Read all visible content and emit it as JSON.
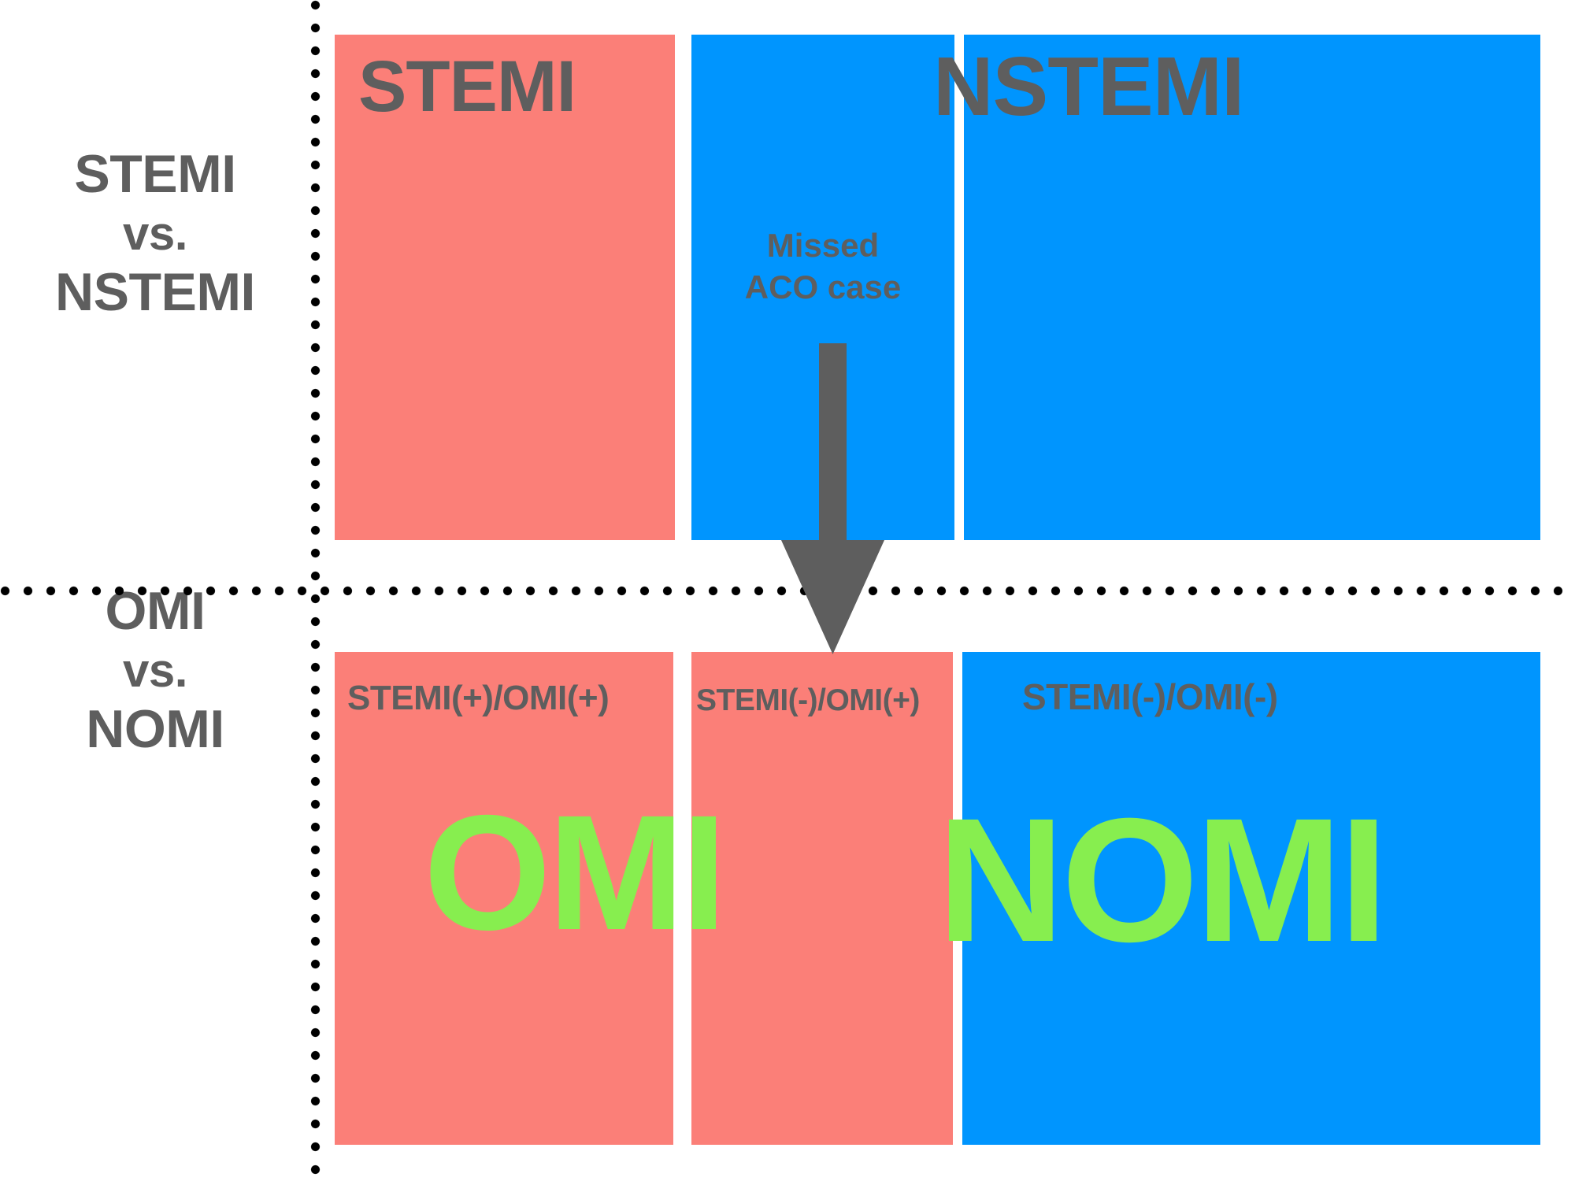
{
  "diagram": {
    "title": "STEMI vs. NSTEMI compared with OMI vs. NOMI paradigm",
    "colors": {
      "red": "#fb7f78",
      "blue": "#0095fe",
      "gray_text": "#5e5e5e",
      "green_text": "#87ee4f",
      "divider": "#000000",
      "background": "#ffffff"
    },
    "rows": [
      {
        "id": "stemi-vs-nstemi",
        "axis_label_lines": [
          "STEMI",
          "vs.",
          "NSTEMI"
        ],
        "headers": [
          {
            "label": "STEMI",
            "color": "red"
          },
          {
            "label": "NSTEMI",
            "color": "blue"
          }
        ],
        "panels": [
          {
            "id": "panel-stemi",
            "color": "red"
          },
          {
            "id": "panel-nstemi-left",
            "color": "blue"
          },
          {
            "id": "panel-nstemi-right",
            "color": "blue"
          }
        ]
      },
      {
        "id": "omi-vs-nomi",
        "axis_label_lines": [
          "OMI",
          "vs.",
          "NOMI"
        ],
        "panels": [
          {
            "id": "panel-omi-pos",
            "color": "red",
            "caption": "STEMI(+)/OMI(+)"
          },
          {
            "id": "panel-omi-occ",
            "color": "red",
            "caption": "STEMI(-)/OMI(+)"
          },
          {
            "id": "panel-nomi",
            "color": "blue",
            "caption": "STEMI(-)/OMI(-)"
          }
        ],
        "verdicts": [
          {
            "label": "OMI",
            "color": "green"
          },
          {
            "label": "NOMI",
            "color": "green"
          }
        ]
      }
    ],
    "annotation": {
      "text": "Missed\nACO case",
      "arrow": "down-arrow"
    },
    "axis_labels": {
      "top_line1": "STEMI",
      "top_line2": "vs.",
      "top_line3": "NSTEMI",
      "bottom_line1": "OMI",
      "bottom_line2": "vs.",
      "bottom_line3": "NOMI"
    },
    "headers": {
      "stemi": "STEMI",
      "nstemi": "NSTEMI"
    },
    "captions": {
      "omi_pos": "STEMI(+)/OMI(+)",
      "omi_occult": "STEMI(-)/OMI(+)",
      "nomi": "STEMI(-)/OMI(-)"
    },
    "verdicts": {
      "omi": "OMI",
      "nomi": "NOMI"
    }
  }
}
